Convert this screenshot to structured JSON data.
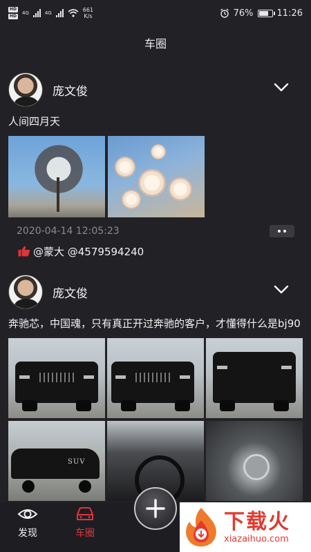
{
  "status_bar": {
    "sim1": "HD",
    "sim2": "HD",
    "net1": "4G",
    "net2": "4G",
    "speed_value": "661",
    "speed_unit": "K/s",
    "battery": "76%",
    "battery_level": 0.76,
    "time": "11:26"
  },
  "header": {
    "title": "车圈"
  },
  "posts": [
    {
      "author": "庞文俊",
      "text": "人间四月天",
      "date": "2020-04-14 12:05:23",
      "likes": "@蒙大 @4579594240"
    },
    {
      "author": "庞文俊",
      "text": "奔驰芯，中国魂，只有真正开过奔驰的客户，才懂得什么是bj90",
      "suv_badge": "SUV"
    }
  ],
  "nav": {
    "discover": "发现",
    "car_circle": "车圈",
    "active": "car_circle",
    "active_color": "#e0343b"
  },
  "watermark": {
    "main": "下载火",
    "sub": "xiazaihuo.com"
  }
}
